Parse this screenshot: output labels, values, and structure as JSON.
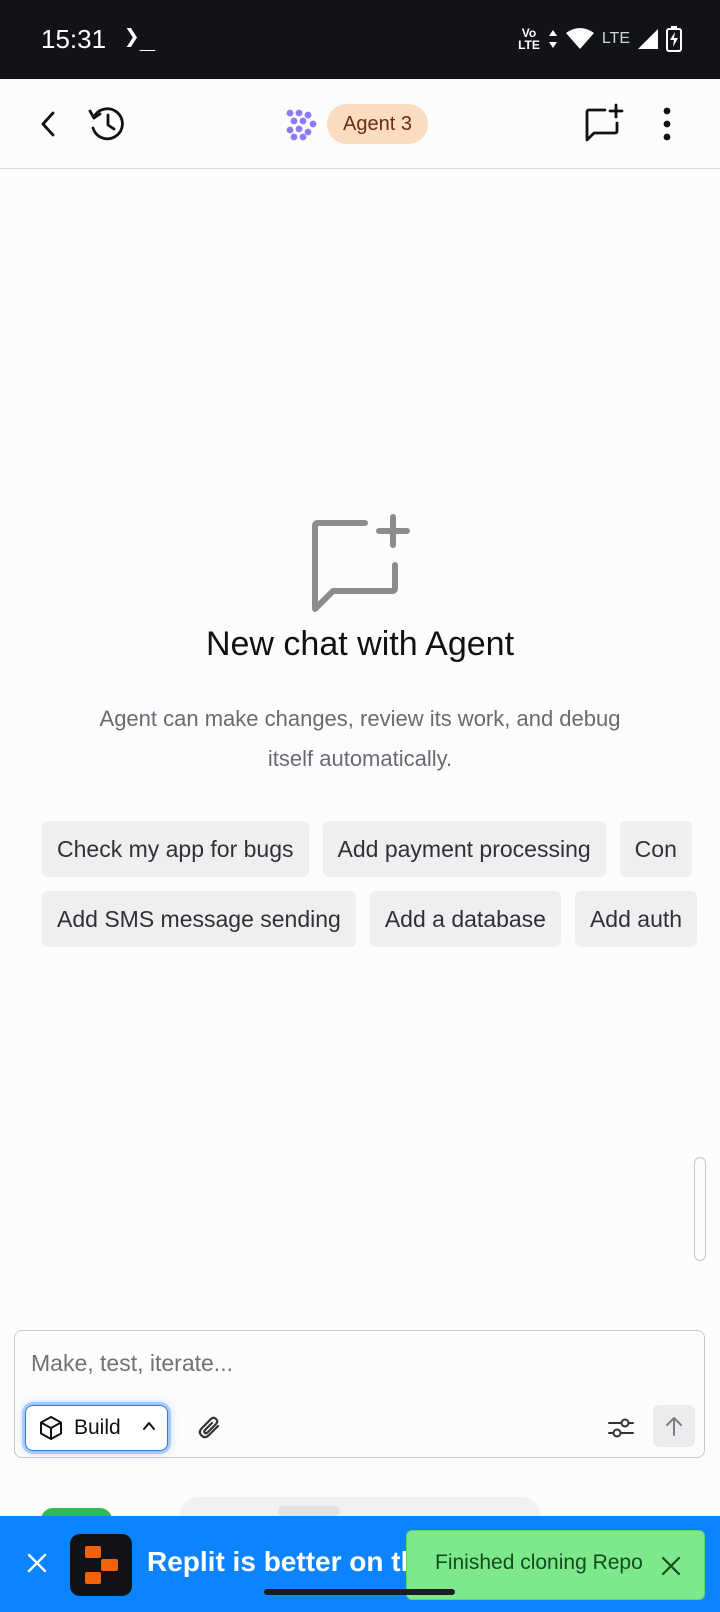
{
  "status_bar": {
    "time": "15:31",
    "terminal_glyph": "❯_",
    "volte_top": "Vo",
    "volte_bottom": "LTE",
    "network_label": "LTE",
    "icons": [
      "terminal-icon",
      "volte-icon",
      "data-arrows-icon",
      "wifi-icon",
      "cell-signal-icon",
      "battery-charging-icon"
    ]
  },
  "header": {
    "back_icon": "back-arrow-icon",
    "history_icon": "history-icon",
    "agent_logo_icon": "agent-logo-icon",
    "agent_badge": "Agent 3",
    "new_chat_icon": "new-chat-icon",
    "more_icon": "more-vertical-icon"
  },
  "empty_state": {
    "icon": "new-chat-icon",
    "title": "New chat with Agent",
    "description": "Agent can make changes, review its work, and debug itself automatically."
  },
  "suggestions": {
    "row1": [
      "Check my app for bugs",
      "Add payment processing",
      "Con"
    ],
    "row2": [
      "Add SMS message sending",
      "Add a database",
      "Add auth"
    ]
  },
  "composer": {
    "placeholder": "Make, test, iterate...",
    "value": "",
    "mode_label": "Build",
    "mode_icon": "cube-icon",
    "mode_chevron": "chevron-up-icon",
    "attach_icon": "paperclip-icon",
    "settings_icon": "sliders-icon",
    "send_icon": "arrow-up-icon"
  },
  "banner": {
    "text": "Replit is better on the app",
    "close_icon": "close-icon",
    "logo_icon": "replit-logo-icon"
  },
  "toast": {
    "text": "Finished cloning Repo",
    "close_icon": "close-icon"
  },
  "colors": {
    "accent_blue": "#0d84ff",
    "badge_bg": "#fcdcc0",
    "badge_text": "#6a2d0e",
    "toast_bg": "#7de88c",
    "replit_orange": "#f26207",
    "agent_purple": "#8b7cf6"
  }
}
